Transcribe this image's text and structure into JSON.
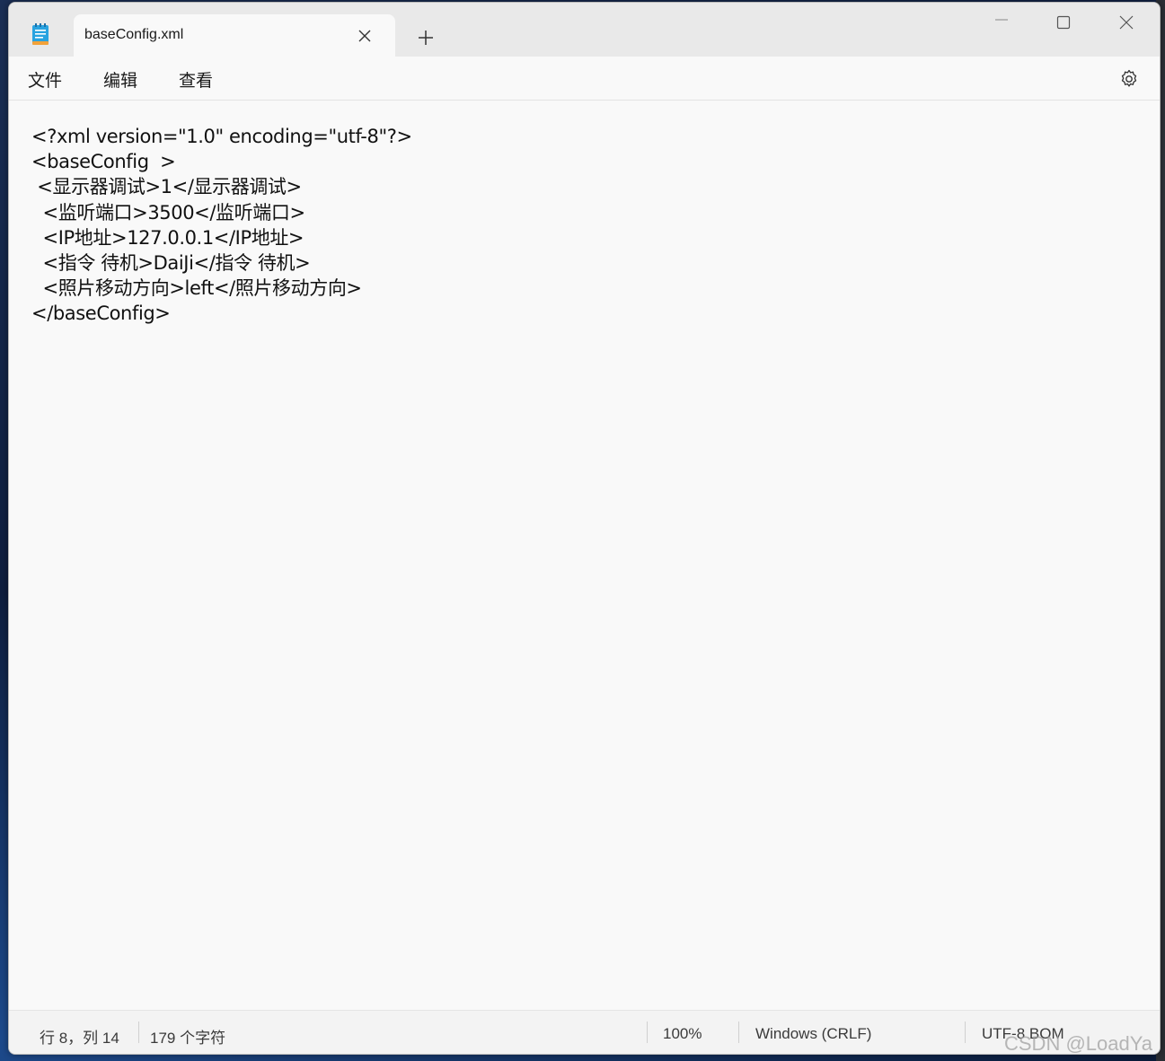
{
  "tab": {
    "title": "baseConfig.xml",
    "close_glyph": "✕",
    "new_tab_glyph": "+"
  },
  "window_controls": {
    "minimize_glyph": "—",
    "maximize_glyph": "☐",
    "close_glyph": "✕"
  },
  "menu": {
    "file": "文件",
    "edit": "编辑",
    "view": "查看"
  },
  "icons": {
    "app": "notepad-icon",
    "settings": "gear-icon"
  },
  "editor": {
    "content": "<?xml version=\"1.0\" encoding=\"utf-8\"?>\n<baseConfig  >\n <显示器调试>1</显示器调试>\n  <监听端口>3500</监听端口>\n  <IP地址>127.0.0.1</IP地址>\n  <指令 待机>DaiJi</指令 待机>\n  <照片移动方向>left</照片移动方向>\n</baseConfig>"
  },
  "status": {
    "position": "行 8，列 14",
    "char_count": "179 个字符",
    "zoom": "100%",
    "line_ending": "Windows (CRLF)",
    "encoding": "UTF-8 BOM"
  },
  "watermark": "CSDN @LoadYa"
}
